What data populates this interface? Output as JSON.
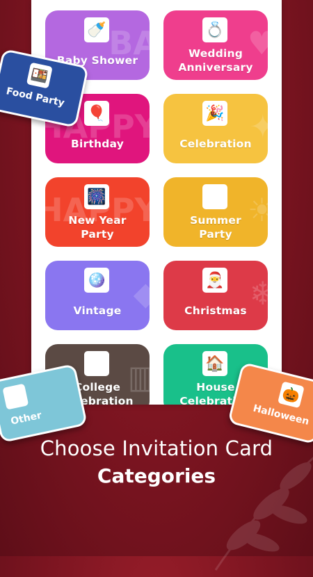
{
  "categories": [
    {
      "label_lines": [
        "Baby Shower"
      ],
      "color": "#b468e0",
      "icon": "baby-shower-icon",
      "glyph": "🍼",
      "deco": "BA"
    },
    {
      "label_lines": [
        "Wedding",
        "Anniversary"
      ],
      "color": "#ef3e8d",
      "icon": "wedding-rings-icon",
      "glyph": "💍",
      "deco": "♥"
    },
    {
      "label_lines": [
        "Birthday"
      ],
      "color": "#e0157d",
      "icon": "birthday-icon",
      "glyph": "🎈",
      "deco": "HAPPY"
    },
    {
      "label_lines": [
        "Celebration"
      ],
      "color": "#f6c340",
      "icon": "celebration-icon",
      "glyph": "🎉",
      "deco": "✦"
    },
    {
      "label_lines": [
        "New Year",
        "Party"
      ],
      "color": "#f2432c",
      "icon": "new-year-icon",
      "glyph": "🎆",
      "deco": "HAPPY"
    },
    {
      "label_lines": [
        "Summer",
        "Party"
      ],
      "color": "#f0b42a",
      "icon": "summer-party-icon",
      "glyph": "🏖",
      "deco": "☀"
    },
    {
      "label_lines": [
        "Vintage"
      ],
      "color": "#8a76f0",
      "icon": "disco-ball-icon",
      "glyph": "🪩",
      "deco": "◆"
    },
    {
      "label_lines": [
        "Christmas"
      ],
      "color": "#dd3a48",
      "icon": "santa-icon",
      "glyph": "🎅",
      "deco": "❄"
    },
    {
      "label_lines": [
        "College",
        "Celebration"
      ],
      "color": "#5b4a44",
      "icon": "college-building-icon",
      "glyph": "🏛",
      "deco": "▥"
    },
    {
      "label_lines": [
        "House",
        "Celebration"
      ],
      "color": "#19c08a",
      "icon": "house-icon",
      "glyph": "🏠",
      "deco": "⌂"
    }
  ],
  "floaters": {
    "food_party": {
      "label": "Food Party",
      "color": "#2a4fa0",
      "icon": "food-tray-icon",
      "glyph": "🍱"
    },
    "other": {
      "label": "Other",
      "color": "#7ec6d8",
      "icon": "envelope-icon",
      "glyph": "✉"
    },
    "halloween": {
      "label": "Halloween",
      "color": "#f4874a",
      "icon": "pumpkin-icon",
      "glyph": "🎃"
    }
  },
  "caption": {
    "line1": "Choose Invitation Card",
    "line2": "Categories"
  }
}
